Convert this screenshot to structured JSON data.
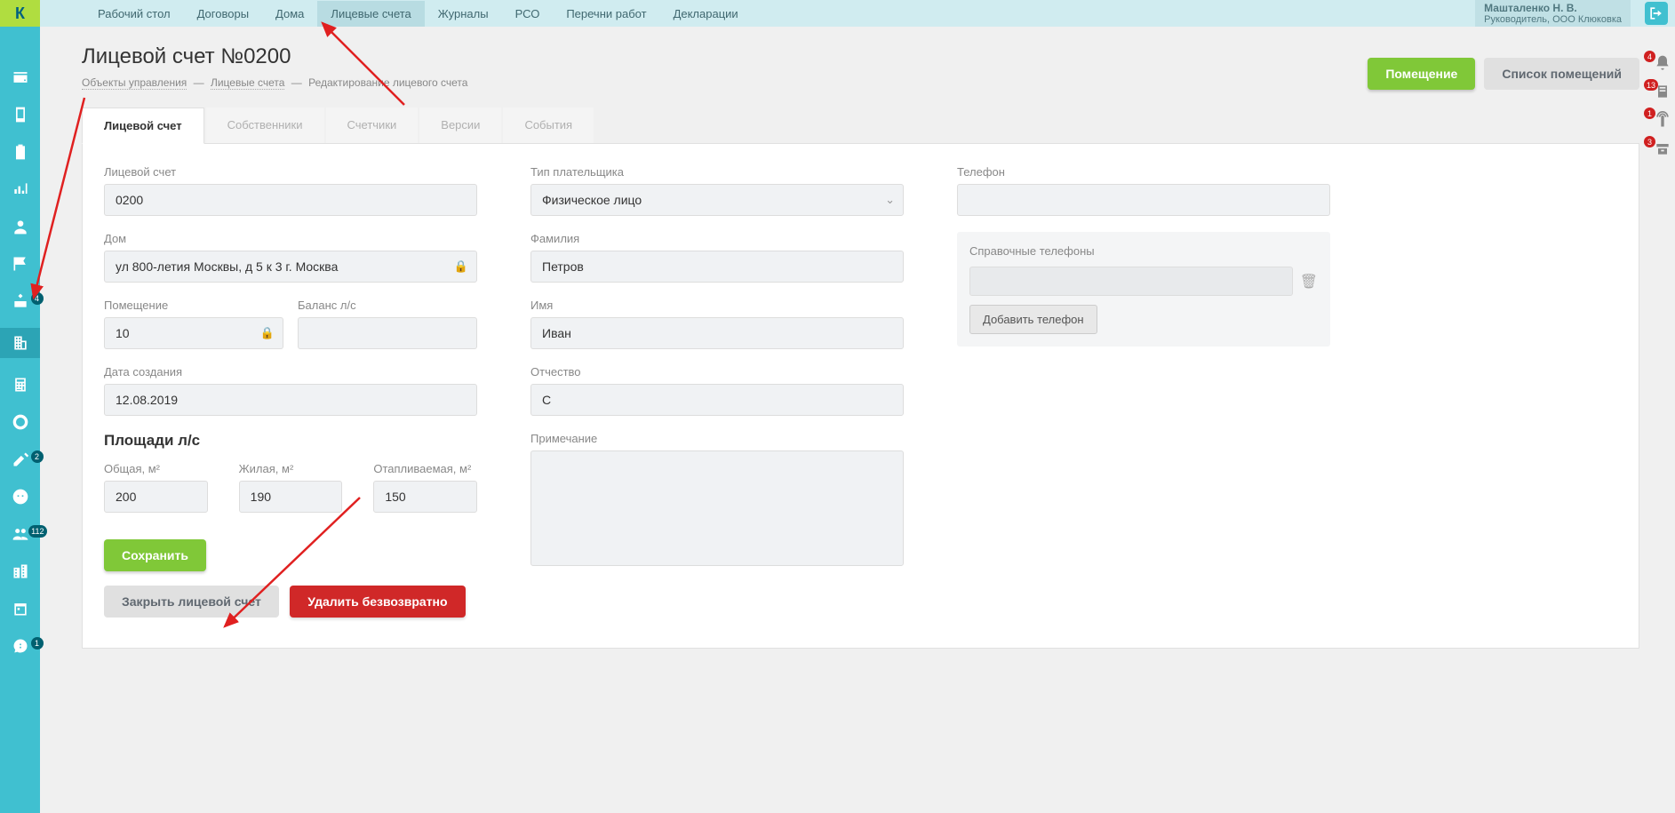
{
  "logo_text": "К",
  "top_menu": [
    "Рабочий стол",
    "Договоры",
    "Дома",
    "Лицевые счета",
    "Журналы",
    "РСО",
    "Перечни работ",
    "Декларации"
  ],
  "top_menu_active_index": 3,
  "user": {
    "name": "Машталенко Н. В.",
    "role": "Руководитель, ООО Клюковка"
  },
  "side_badges": {
    "i5": "4",
    "i9": "2",
    "i11": "112",
    "i14": "1"
  },
  "right_badges": {
    "bell": "4",
    "r2": "13",
    "r3": "1",
    "r4": "3"
  },
  "page_title": "Лицевой счет №0200",
  "breadcrumb": {
    "l1": "Объекты управления",
    "l2": "Лицевые счета",
    "l3": "Редактирование лицевого счета"
  },
  "header_buttons": {
    "room": "Помещение",
    "list": "Список помещений"
  },
  "tabs": [
    "Лицевой счет",
    "Собственники",
    "Счетчики",
    "Версии",
    "События"
  ],
  "labels": {
    "account": "Лицевой счет",
    "house": "Дом",
    "premise": "Помещение",
    "balance": "Баланс л/с",
    "date_created": "Дата создания",
    "areas": "Площади л/с",
    "area_total": "Общая, м²",
    "area_living": "Жилая, м²",
    "area_heated": "Отапливаемая, м²",
    "payer_type": "Тип плательщика",
    "lastname": "Фамилия",
    "firstname": "Имя",
    "middlename": "Отчество",
    "note": "Примечание",
    "phone": "Телефон",
    "ref_phones": "Справочные телефоны",
    "add_phone": "Добавить телефон"
  },
  "values": {
    "account": "0200",
    "house": "ул 800-летия Москвы, д 5 к 3 г. Москва",
    "premise": "10",
    "balance": "",
    "date_created": "12.08.2019",
    "area_total": "200",
    "area_living": "190",
    "area_heated": "150",
    "payer_type": "Физическое лицо",
    "lastname": "Петров",
    "firstname": "Иван",
    "middlename": "C",
    "note": "",
    "phone": ""
  },
  "buttons": {
    "save": "Сохранить",
    "close_account": "Закрыть лицевой счет",
    "delete": "Удалить безвозвратно"
  }
}
